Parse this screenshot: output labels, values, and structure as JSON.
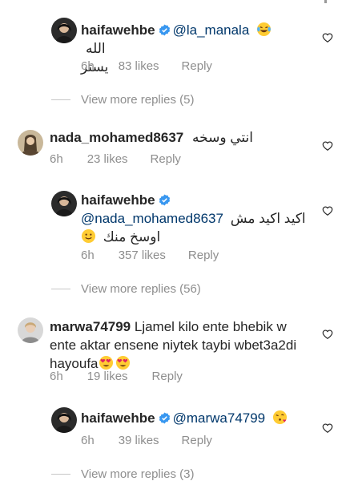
{
  "comments": [
    {
      "username": "haifawehbe",
      "mention": "@la_manala",
      "text_line1": "الله",
      "text_line2": "يستر",
      "emoji": "laughing-tears",
      "time": "6h",
      "likes": "83 likes",
      "reply": "Reply"
    },
    {
      "username": "nada_mohamed8637",
      "text": "انتي وسخه",
      "time": "6h",
      "likes": "23 likes",
      "reply": "Reply"
    },
    {
      "username": "haifawehbe",
      "mention": "@nada_mohamed8637",
      "text_line1": "اكيد اكيد مش",
      "text_line2": "اوسخ منك",
      "emoji": "slight-smile",
      "time": "6h",
      "likes": "357 likes",
      "reply": "Reply"
    },
    {
      "username": "marwa74799",
      "text_line1": "Ljamel kilo ente bhebik w",
      "text_line2": "ente aktar ensene niytek taybi wbet3a2di",
      "text_line3": "hayoufa",
      "emoji": "heart-eyes",
      "time": "6h",
      "likes": "19 likes",
      "reply": "Reply"
    },
    {
      "username": "haifawehbe",
      "mention": "@marwa74799",
      "emoji": "kissing-heart",
      "time": "6h",
      "likes": "39 likes",
      "reply": "Reply"
    }
  ],
  "view_more": [
    "View more replies (5)",
    "View more replies (56)",
    "View more replies (3)"
  ],
  "colors": {
    "text": "#262626",
    "secondary": "#8e8e8e",
    "mention": "#00376b",
    "verified": "#3897f0"
  }
}
